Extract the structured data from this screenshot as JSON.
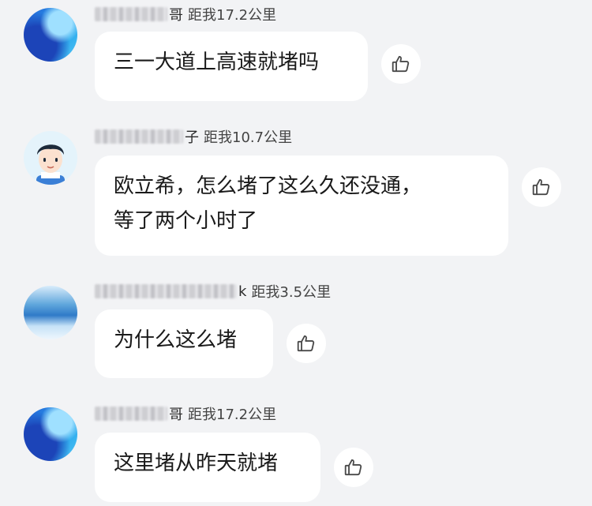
{
  "messages": [
    {
      "name_visible": "哥",
      "distance": "距我17.2公里",
      "lines": [
        "三一大道上高速就堵吗"
      ],
      "avatar_icon": "blue-abstract-avatar-icon"
    },
    {
      "name_visible": "子",
      "distance": "距我10.7公里",
      "lines": [
        "欧立希，怎么堵了这么久还没通，",
        "等了两个小时了"
      ],
      "avatar_icon": "cartoon-boy-avatar-icon"
    },
    {
      "name_visible": "k",
      "distance": "距我3.5公里",
      "lines": [
        "为什么这么堵"
      ],
      "avatar_icon": "sea-landscape-avatar-icon"
    },
    {
      "name_visible": "哥",
      "distance": "距我17.2公里",
      "lines": [
        "这里堵从昨天就堵"
      ],
      "avatar_icon": "blue-abstract-avatar-icon"
    }
  ],
  "like_icon": "thumbs-up-icon"
}
